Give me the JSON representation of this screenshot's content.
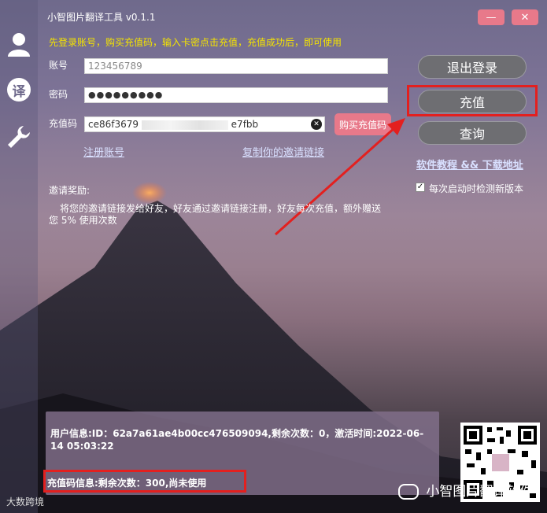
{
  "window": {
    "title": "小智图片翻译工具  v0.1.1",
    "minimize_label": "—",
    "close_label": "✕"
  },
  "sidebar": {
    "items": [
      {
        "icon": "user-icon"
      },
      {
        "label": "译",
        "icon": "translate-icon"
      },
      {
        "icon": "wrench-icon"
      }
    ]
  },
  "notice": "先登录账号，购买充值码，输入卡密点击充值，充值成功后，即可使用",
  "form": {
    "account_label": "账号",
    "account_value": "123456789",
    "password_label": "密码",
    "password_value": "●●●●●●●●●",
    "code_label": "充值码",
    "code_value_left": "ce86f3679",
    "code_value_right": "e7fbb",
    "clear_icon_label": "✕",
    "buy_button": "购买充值码",
    "register_link": "注册账号",
    "copy_invite_link": "复制你的邀请链接"
  },
  "actions": {
    "logout": "退出登录",
    "recharge": "充值",
    "query": "查询",
    "tutorial_link": "软件教程  &&  下载地址",
    "check_update_label": "每次启动时检测新版本",
    "check_update_checked": "✓"
  },
  "invite": {
    "title": "邀请奖励:",
    "text": "将您的邀请链接发给好友，好友通过邀请链接注册，好友每次充值，额外赠送您 5% 使用次数"
  },
  "info": {
    "user_info": "用户信息:ID：62a7a61ae4b00cc476509094,剩余次数：0，激活时间:2022-06-14 05:03:22",
    "code_info": "充值码信息:剩余次数：300,尚未使用"
  },
  "watermark": {
    "brand": "小智图片翻译软件",
    "corner": "大数跨境"
  },
  "colors": {
    "accent_pink": "#e8798a",
    "notice_yellow": "#f5e400",
    "highlight_red": "#e3201f"
  }
}
